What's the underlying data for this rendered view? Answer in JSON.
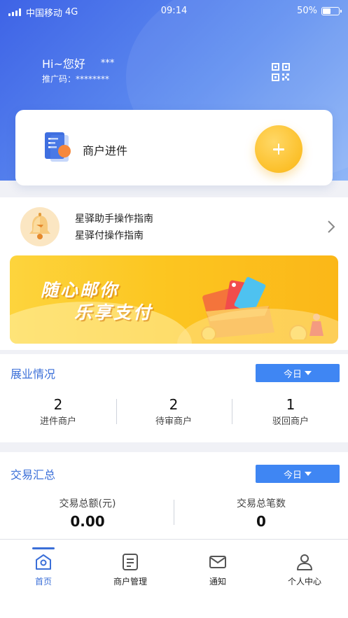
{
  "status_bar": {
    "carrier": "中国移动",
    "network": "4G",
    "time": "09:14",
    "battery": "50%",
    "battery_level": 0.5
  },
  "header": {
    "greeting": "Hi~您好",
    "user_name": "***",
    "promo_code": "推广码：********"
  },
  "merchant_card": {
    "label": "商户进件"
  },
  "guides": {
    "items": [
      "星驿助手操作指南",
      "星驿付操作指南"
    ]
  },
  "banner": {
    "line1": "随心邮你",
    "line2": "乐享支付"
  },
  "business": {
    "title": "展业情况",
    "period": "今日",
    "stats": [
      {
        "value": "2",
        "label": "进件商户"
      },
      {
        "value": "2",
        "label": "待审商户"
      },
      {
        "value": "1",
        "label": "驳回商户"
      }
    ]
  },
  "transactions": {
    "title": "交易汇总",
    "period": "今日",
    "stats": [
      {
        "label": "交易总额(元)",
        "value": "0.00"
      },
      {
        "label": "交易总笔数",
        "value": "0"
      }
    ]
  },
  "tab_bar": {
    "active": "首页",
    "items": [
      {
        "label": "首页",
        "icon": "home-icon"
      },
      {
        "label": "商户管理",
        "icon": "merchant-list-icon"
      },
      {
        "label": "通知",
        "icon": "mail-icon"
      },
      {
        "label": "个人中心",
        "icon": "person-icon"
      }
    ]
  },
  "colors": {
    "primary": "#3b6fd8",
    "accent_yellow": "#fcc02a",
    "button_blue": "#3f86f3"
  }
}
